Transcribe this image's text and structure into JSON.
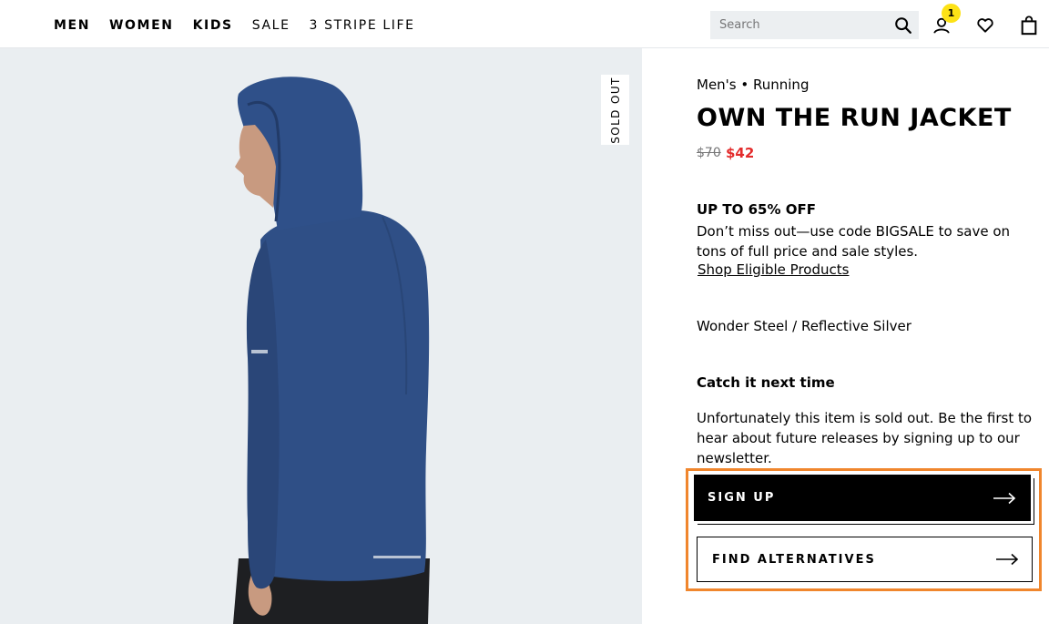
{
  "nav": {
    "items": [
      {
        "label": "MEN",
        "weight": "bold"
      },
      {
        "label": "WOMEN",
        "weight": "bold"
      },
      {
        "label": "KIDS",
        "weight": "bold"
      },
      {
        "label": "SALE",
        "weight": "light"
      },
      {
        "label": "3 STRIPE LIFE",
        "weight": "light"
      }
    ]
  },
  "search": {
    "placeholder": "Search"
  },
  "account": {
    "badge_count": "1"
  },
  "icons": [
    "search-icon",
    "account-icon",
    "wishlist-heart-icon",
    "shopping-bag-icon",
    "arrow-right-icon"
  ],
  "product": {
    "sold_out_label": "SOLD OUT",
    "breadcrumb": "Men's • Running",
    "title": "OWN THE RUN JACKET",
    "price_original": "$70",
    "price_sale": "$42",
    "color": "Wonder Steel / Reflective Silver"
  },
  "promo": {
    "heading": "UP TO 65% OFF",
    "text": "Don’t miss out—use code BIGSALE to save on tons of full price and sale styles.",
    "link": "Shop Eligible Products"
  },
  "sold_out": {
    "heading": "Catch it next time",
    "text": "Unfortunately this item is sold out. Be the first to hear about future releases by signing up to our newsletter."
  },
  "buttons": {
    "signup": "SIGN UP",
    "alternatives": "FIND ALTERNATIVES"
  },
  "colors": {
    "sale_red": "#e32b2b",
    "badge_yellow": "#fde216",
    "highlight_orange": "#f0862d",
    "jacket_blue": "#2f4f86"
  }
}
